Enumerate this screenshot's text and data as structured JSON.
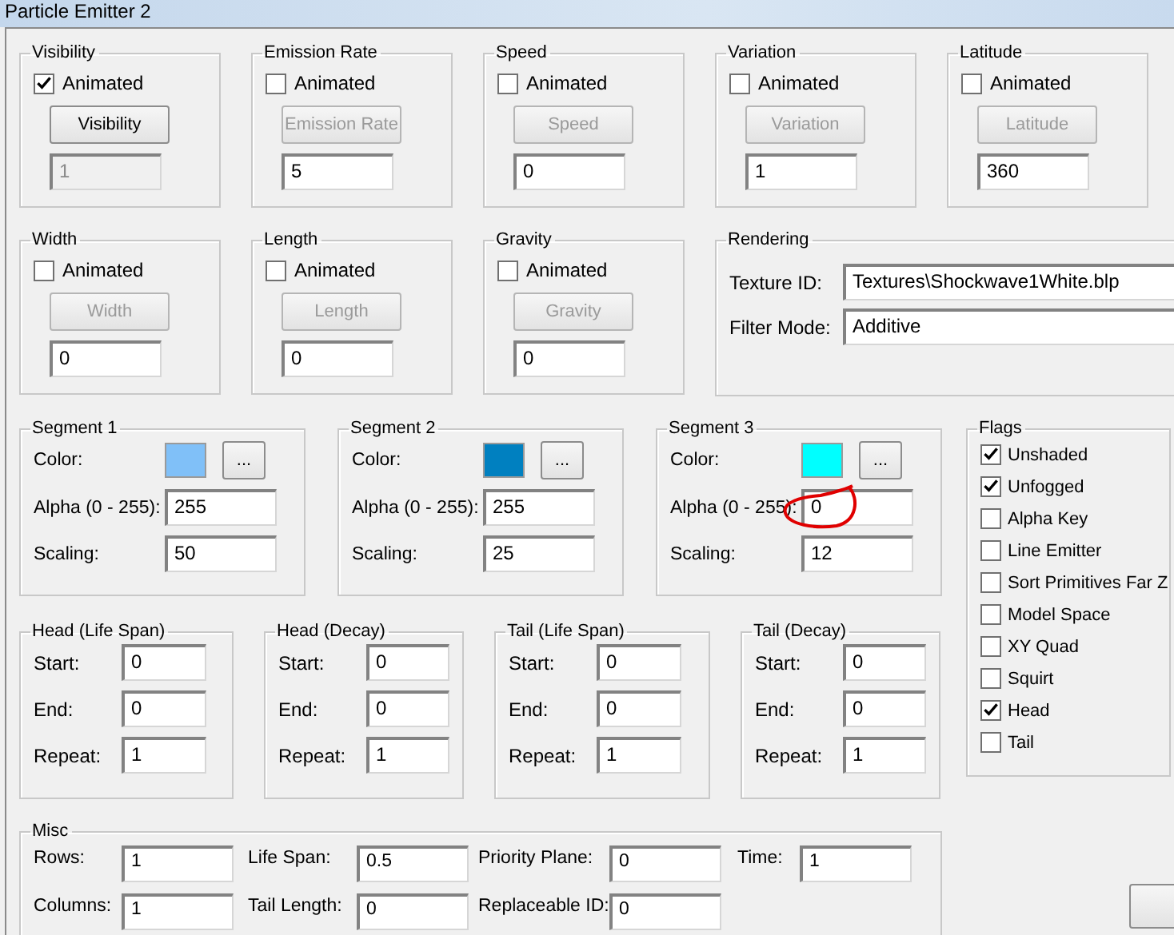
{
  "window": {
    "title": "Particle Emitter 2"
  },
  "properties": [
    {
      "title": "Visibility",
      "animated": {
        "label": "Animated",
        "checked": true
      },
      "button": {
        "label": "Visibility",
        "disabled": false
      },
      "value": {
        "text": "1",
        "disabled": true
      }
    },
    {
      "title": "Emission Rate",
      "animated": {
        "label": "Animated",
        "checked": false
      },
      "button": {
        "label": "Emission Rate",
        "disabled": true
      },
      "value": {
        "text": "5",
        "disabled": false
      }
    },
    {
      "title": "Speed",
      "animated": {
        "label": "Animated",
        "checked": false
      },
      "button": {
        "label": "Speed",
        "disabled": true
      },
      "value": {
        "text": "0",
        "disabled": false
      }
    },
    {
      "title": "Variation",
      "animated": {
        "label": "Animated",
        "checked": false
      },
      "button": {
        "label": "Variation",
        "disabled": true
      },
      "value": {
        "text": "1",
        "disabled": false
      }
    },
    {
      "title": "Latitude",
      "animated": {
        "label": "Animated",
        "checked": false
      },
      "button": {
        "label": "Latitude",
        "disabled": true
      },
      "value": {
        "text": "360",
        "disabled": false
      }
    },
    {
      "title": "Width",
      "animated": {
        "label": "Animated",
        "checked": false
      },
      "button": {
        "label": "Width",
        "disabled": true
      },
      "value": {
        "text": "0",
        "disabled": false
      }
    },
    {
      "title": "Length",
      "animated": {
        "label": "Animated",
        "checked": false
      },
      "button": {
        "label": "Length",
        "disabled": true
      },
      "value": {
        "text": "0",
        "disabled": false
      }
    },
    {
      "title": "Gravity",
      "animated": {
        "label": "Animated",
        "checked": false
      },
      "button": {
        "label": "Gravity",
        "disabled": true
      },
      "value": {
        "text": "0",
        "disabled": false
      }
    }
  ],
  "rendering": {
    "title": "Rendering",
    "fields": [
      {
        "label": "Texture ID:",
        "value": "Textures\\Shockwave1White.blp"
      },
      {
        "label": "Filter Mode:",
        "value": "Additive"
      }
    ]
  },
  "segments": [
    {
      "title": "Segment 1",
      "color_label": "Color:",
      "color": "#80c0f8",
      "picker": "...",
      "alpha_label": "Alpha (0 - 255):",
      "alpha": "255",
      "alpha_circled": false,
      "scaling_label": "Scaling:",
      "scaling": "50"
    },
    {
      "title": "Segment 2",
      "color_label": "Color:",
      "color": "#0080c0",
      "picker": "...",
      "alpha_label": "Alpha (0 - 255):",
      "alpha": "255",
      "alpha_circled": false,
      "scaling_label": "Scaling:",
      "scaling": "25"
    },
    {
      "title": "Segment 3",
      "color_label": "Color:",
      "color": "#00ffff",
      "picker": "...",
      "alpha_label": "Alpha (0 - 255):",
      "alpha": "0",
      "alpha_circled": true,
      "scaling_label": "Scaling:",
      "scaling": "12"
    }
  ],
  "flags": {
    "title": "Flags",
    "items": [
      {
        "label": "Unshaded",
        "checked": true
      },
      {
        "label": "Unfogged",
        "checked": true
      },
      {
        "label": "Alpha Key",
        "checked": false
      },
      {
        "label": "Line Emitter",
        "checked": false
      },
      {
        "label": "Sort Primitives Far Z",
        "checked": false
      },
      {
        "label": "Model Space",
        "checked": false
      },
      {
        "label": "XY Quad",
        "checked": false
      },
      {
        "label": "Squirt",
        "checked": false
      },
      {
        "label": "Head",
        "checked": true
      },
      {
        "label": "Tail",
        "checked": false
      }
    ]
  },
  "timings": [
    {
      "title": "Head (Life Span)",
      "fields": [
        {
          "label": "Start:",
          "value": "0"
        },
        {
          "label": "End:",
          "value": "0"
        },
        {
          "label": "Repeat:",
          "value": "1"
        }
      ]
    },
    {
      "title": "Head (Decay)",
      "fields": [
        {
          "label": "Start:",
          "value": "0"
        },
        {
          "label": "End:",
          "value": "0"
        },
        {
          "label": "Repeat:",
          "value": "1"
        }
      ]
    },
    {
      "title": "Tail (Life Span)",
      "fields": [
        {
          "label": "Start:",
          "value": "0"
        },
        {
          "label": "End:",
          "value": "0"
        },
        {
          "label": "Repeat:",
          "value": "1"
        }
      ]
    },
    {
      "title": "Tail (Decay)",
      "fields": [
        {
          "label": "Start:",
          "value": "0"
        },
        {
          "label": "End:",
          "value": "0"
        },
        {
          "label": "Repeat:",
          "value": "1"
        }
      ]
    }
  ],
  "misc": {
    "title": "Misc",
    "fields": [
      {
        "label": "Rows:",
        "value": "1"
      },
      {
        "label": "Life Span:",
        "value": "0.5"
      },
      {
        "label": "Priority Plane:",
        "value": "0"
      },
      {
        "label": "Time:",
        "value": "1"
      },
      {
        "label": "Columns:",
        "value": "1"
      },
      {
        "label": "Tail Length:",
        "value": "0"
      },
      {
        "label": "Replaceable ID:",
        "value": "0"
      }
    ]
  }
}
